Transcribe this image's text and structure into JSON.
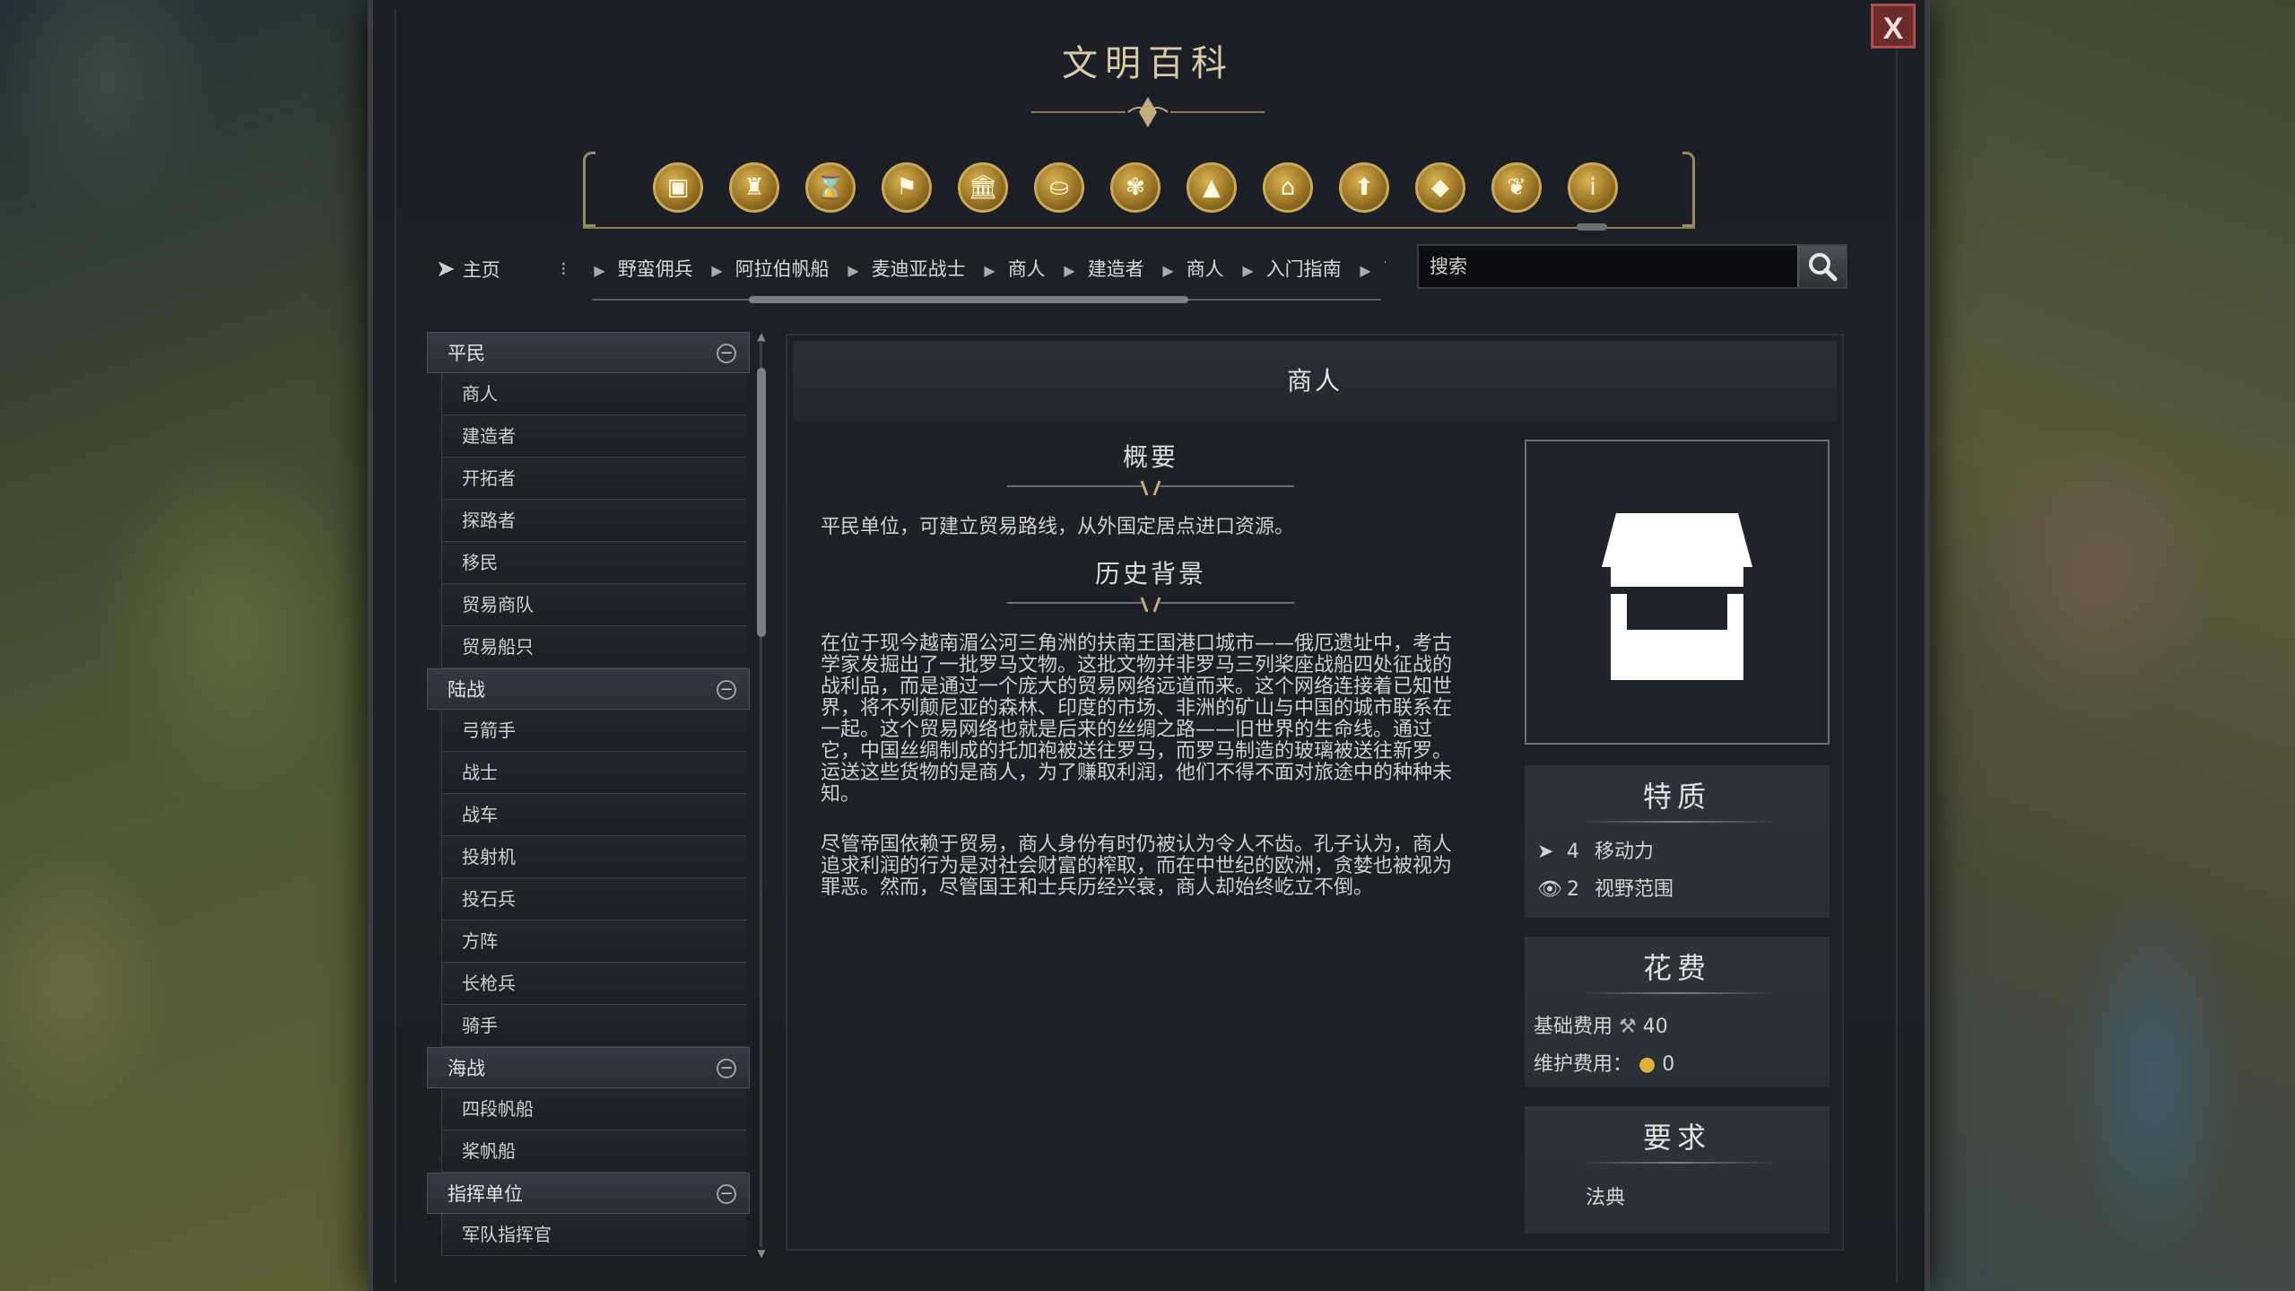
{
  "window": {
    "title": "文明百科",
    "close_label": "X"
  },
  "category_icons": [
    {
      "name": "units",
      "glyph": "▣"
    },
    {
      "name": "buildings",
      "glyph": "♜"
    },
    {
      "name": "eras",
      "glyph": "⌛"
    },
    {
      "name": "civilizations",
      "glyph": "⚑"
    },
    {
      "name": "governments",
      "glyph": "🏛"
    },
    {
      "name": "resources",
      "glyph": "⛀"
    },
    {
      "name": "traditions",
      "glyph": "✾"
    },
    {
      "name": "terrain",
      "glyph": "▲"
    },
    {
      "name": "districts",
      "glyph": "⌂"
    },
    {
      "name": "progress",
      "glyph": "⬆"
    },
    {
      "name": "diplomacy",
      "glyph": "◆"
    },
    {
      "name": "religion",
      "glyph": "❦"
    },
    {
      "name": "info",
      "glyph": "i"
    }
  ],
  "nav": {
    "home_label": "主页",
    "breadcrumb_lead": "⁝",
    "breadcrumbs": [
      "野蛮佣兵",
      "阿拉伯帆船",
      "麦迪亚战士",
      "商人",
      "建造者",
      "商人",
      "入门指南",
      "商人"
    ]
  },
  "search": {
    "placeholder": "搜索"
  },
  "sidebar": {
    "groups": [
      {
        "label": "平民",
        "items": [
          "商人",
          "建造者",
          "开拓者",
          "探路者",
          "移民",
          "贸易商队",
          "贸易船只"
        ]
      },
      {
        "label": "陆战",
        "items": [
          "弓箭手",
          "战士",
          "战车",
          "投射机",
          "投石兵",
          "方阵",
          "长枪兵",
          "骑手"
        ]
      },
      {
        "label": "海战",
        "items": [
          "四段帆船",
          "桨帆船"
        ]
      },
      {
        "label": "指挥单位",
        "items": [
          "军队指挥官"
        ]
      }
    ]
  },
  "article": {
    "title": "商人",
    "overview_title": "概要",
    "overview_text": "平民单位，可建立贸易路线，从外国定居点进口资源。",
    "history_title": "历史背景",
    "history_p1": "在位于现今越南湄公河三角洲的扶南王国港口城市——俄厄遗址中，考古学家发掘出了一批罗马文物。这批文物并非罗马三列桨座战船四处征战的战利品，而是通过一个庞大的贸易网络远道而来。这个网络连接着已知世界，将不列颠尼亚的森林、印度的市场、非洲的矿山与中国的城市联系在一起。这个贸易网络也就是后来的丝绸之路——旧世界的生命线。通过它，中国丝绸制成的托加袍被送往罗马，而罗马制造的玻璃被送往新罗。运送这些货物的是商人，为了赚取利润，他们不得不面对旅途中的种种未知。",
    "history_p2": "尽管帝国依赖于贸易，商人身份有时仍被认为令人不齿。孔子认为，商人追求利润的行为是对社会财富的榨取，而在中世纪的欧洲，贪婪也被视为罪恶。然而，尽管国王和士兵历经兴衰，商人却始终屹立不倒。"
  },
  "traits": {
    "title": "特质",
    "movement_icon": "➤",
    "movement_value": "4",
    "movement_label": "移动力",
    "sight_icon": "👁",
    "sight_value": "2",
    "sight_label": "视野范围"
  },
  "cost": {
    "title": "花费",
    "base_label": "基础费用",
    "base_icon": "⚒",
    "base_value": "40",
    "upkeep_label": "维护费用：",
    "upkeep_icon": "●",
    "upkeep_value": "0"
  },
  "requirements": {
    "title": "要求",
    "item": "法典"
  },
  "colors": {
    "panel_bg": "#1c2026",
    "accent_gold": "#c9a85a",
    "close_red": "#6e2b2b"
  }
}
